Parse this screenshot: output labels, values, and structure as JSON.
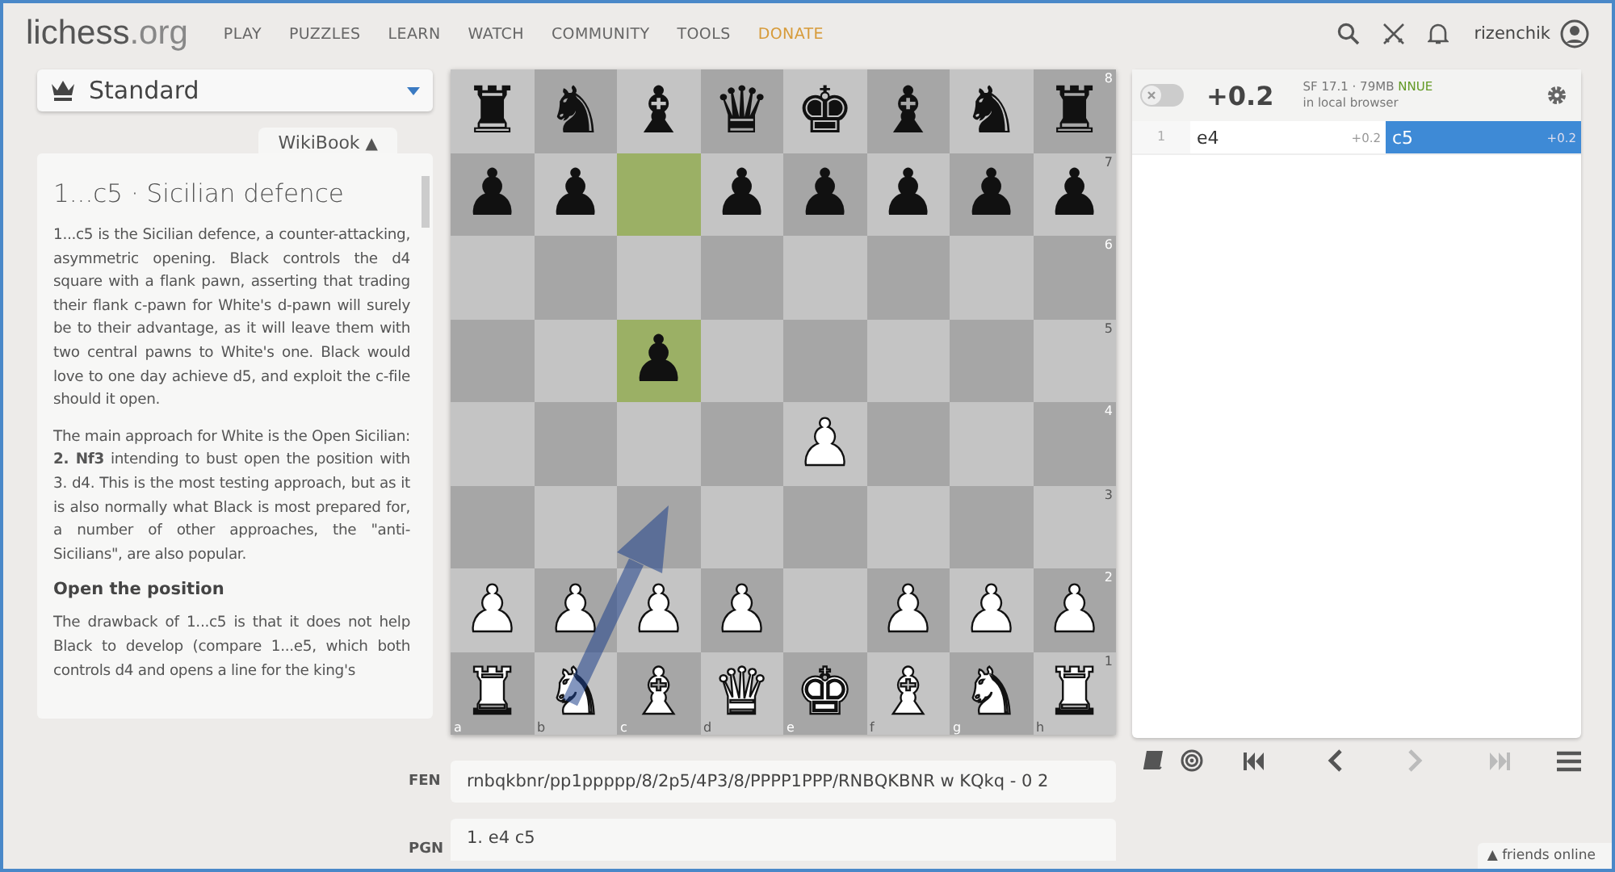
{
  "header": {
    "logo": {
      "name": "lichess",
      "suffix": ".org"
    },
    "nav": [
      {
        "label": "PLAY",
        "kind": "link"
      },
      {
        "label": "PUZZLES",
        "kind": "link"
      },
      {
        "label": "LEARN",
        "kind": "link"
      },
      {
        "label": "WATCH",
        "kind": "link"
      },
      {
        "label": "COMMUNITY",
        "kind": "link"
      },
      {
        "label": "TOOLS",
        "kind": "link"
      },
      {
        "label": "DONATE",
        "kind": "donate"
      }
    ],
    "user": "rizenchik"
  },
  "variant": {
    "label": "Standard"
  },
  "wikibook": {
    "tab": "WikiBook",
    "tab_icon": "▲",
    "expanded": true,
    "title": "1...c5 · Sicilian defence",
    "blocks": [
      {
        "kind": "p",
        "text": "1...c5 is the Sicilian defence, a counter-attacking, asymmetric opening. Black controls the d4 square with a flank pawn, asserting that trading their flank c-pawn for White's d-pawn will surely be to their advantage, as it will leave them with two central pawns to White's one. Black would love to one day achieve d5, and exploit the c-file should it open."
      },
      {
        "kind": "p",
        "text": "The main approach for White is the Open Sicilian: **2. Nf3** intending to bust open the position with 3. d4. This is the most testing approach, but as it is also normally what Black is most prepared for, a number of other approaches, the \"anti-Sicilians\", are also popular."
      },
      {
        "kind": "h",
        "text": "Open the position"
      },
      {
        "kind": "p",
        "text": "The drawback of 1...c5 is that it does not help Black to develop (compare 1...e5, which both controls d4 and opens a line for the king's"
      }
    ]
  },
  "board": {
    "rank_labels": [
      "8",
      "7",
      "6",
      "5",
      "4",
      "3",
      "2",
      "1"
    ],
    "file_labels": [
      "a",
      "b",
      "c",
      "d",
      "e",
      "f",
      "g",
      "h"
    ],
    "ranks": [
      [
        {
          "piece": "♜",
          "kind": "black",
          "highlighted": false
        },
        {
          "piece": "♞",
          "kind": "black",
          "highlighted": false
        },
        {
          "piece": "♝",
          "kind": "black",
          "highlighted": false
        },
        {
          "piece": "♛",
          "kind": "black",
          "highlighted": false
        },
        {
          "piece": "♚",
          "kind": "black",
          "highlighted": false
        },
        {
          "piece": "♝",
          "kind": "black",
          "highlighted": false
        },
        {
          "piece": "♞",
          "kind": "black",
          "highlighted": false
        },
        {
          "piece": "♜",
          "kind": "black",
          "highlighted": false
        }
      ],
      [
        {
          "piece": "♟",
          "kind": "black",
          "highlighted": false
        },
        {
          "piece": "♟",
          "kind": "black",
          "highlighted": false
        },
        {
          "highlighted": true
        },
        {
          "piece": "♟",
          "kind": "black",
          "highlighted": false
        },
        {
          "piece": "♟",
          "kind": "black",
          "highlighted": false
        },
        {
          "piece": "♟",
          "kind": "black",
          "highlighted": false
        },
        {
          "piece": "♟",
          "kind": "black",
          "highlighted": false
        },
        {
          "piece": "♟",
          "kind": "black",
          "highlighted": false
        }
      ],
      [
        {
          "highlighted": false
        },
        {
          "highlighted": false
        },
        {
          "highlighted": false
        },
        {
          "highlighted": false
        },
        {
          "highlighted": false
        },
        {
          "highlighted": false
        },
        {
          "highlighted": false
        },
        {
          "highlighted": false
        }
      ],
      [
        {
          "highlighted": false
        },
        {
          "highlighted": false
        },
        {
          "piece": "♟",
          "kind": "black",
          "highlighted": true
        },
        {
          "highlighted": false
        },
        {
          "highlighted": false
        },
        {
          "highlighted": false
        },
        {
          "highlighted": false
        },
        {
          "highlighted": false
        }
      ],
      [
        {
          "highlighted": false
        },
        {
          "highlighted": false
        },
        {
          "highlighted": false
        },
        {
          "highlighted": false
        },
        {
          "piece": "♟",
          "kind": "white",
          "highlighted": false
        },
        {
          "highlighted": false
        },
        {
          "highlighted": false
        },
        {
          "highlighted": false
        }
      ],
      [
        {
          "highlighted": false
        },
        {
          "highlighted": false
        },
        {
          "highlighted": false
        },
        {
          "highlighted": false
        },
        {
          "highlighted": false
        },
        {
          "highlighted": false
        },
        {
          "highlighted": false
        },
        {
          "highlighted": false
        }
      ],
      [
        {
          "piece": "♟",
          "kind": "white",
          "highlighted": false
        },
        {
          "piece": "♟",
          "kind": "white",
          "highlighted": false
        },
        {
          "piece": "♟",
          "kind": "white",
          "highlighted": false
        },
        {
          "piece": "♟",
          "kind": "white",
          "highlighted": false
        },
        {
          "highlighted": false
        },
        {
          "piece": "♟",
          "kind": "white",
          "highlighted": false
        },
        {
          "piece": "♟",
          "kind": "white",
          "highlighted": false
        },
        {
          "piece": "♟",
          "kind": "white",
          "highlighted": false
        }
      ],
      [
        {
          "piece": "♜",
          "kind": "white",
          "highlighted": false
        },
        {
          "piece": "♞",
          "kind": "white",
          "highlighted": false
        },
        {
          "piece": "♝",
          "kind": "white",
          "highlighted": false
        },
        {
          "piece": "♛",
          "kind": "white",
          "highlighted": false
        },
        {
          "piece": "♚",
          "kind": "white",
          "highlighted": false
        },
        {
          "piece": "♝",
          "kind": "white",
          "highlighted": false
        },
        {
          "piece": "♞",
          "kind": "white",
          "highlighted": false
        },
        {
          "piece": "♜",
          "kind": "white",
          "highlighted": false
        }
      ]
    ]
  },
  "fen": {
    "label": "FEN",
    "value": "rnbqkbnr/pp1ppppp/8/2p5/4P3/8/PPPP1PPP/RNBQKBNR w KQkq - 0 2"
  },
  "pgn": {
    "label": "PGN",
    "value": "1. e4 c5"
  },
  "engine": {
    "on": false,
    "eval": "+0.2",
    "name": "SF 17.1 · 79MB",
    "badge": "NNUE",
    "location": "in local browser"
  },
  "moves": [
    {
      "number": "1",
      "white": {
        "san": "e4",
        "eval": "+0.2",
        "selected": false
      },
      "black": {
        "san": "c5",
        "eval": "+0.2",
        "selected": true
      }
    }
  ],
  "controls": [
    {
      "kind": "book"
    },
    {
      "kind": "target"
    },
    {
      "kind": "first",
      "disabled": false
    },
    {
      "kind": "prev",
      "disabled": false
    },
    {
      "kind": "next",
      "disabled": true
    },
    {
      "kind": "last",
      "disabled": true
    },
    {
      "kind": "menu"
    }
  ],
  "friends": {
    "icon": "▲",
    "label": "friends online"
  }
}
